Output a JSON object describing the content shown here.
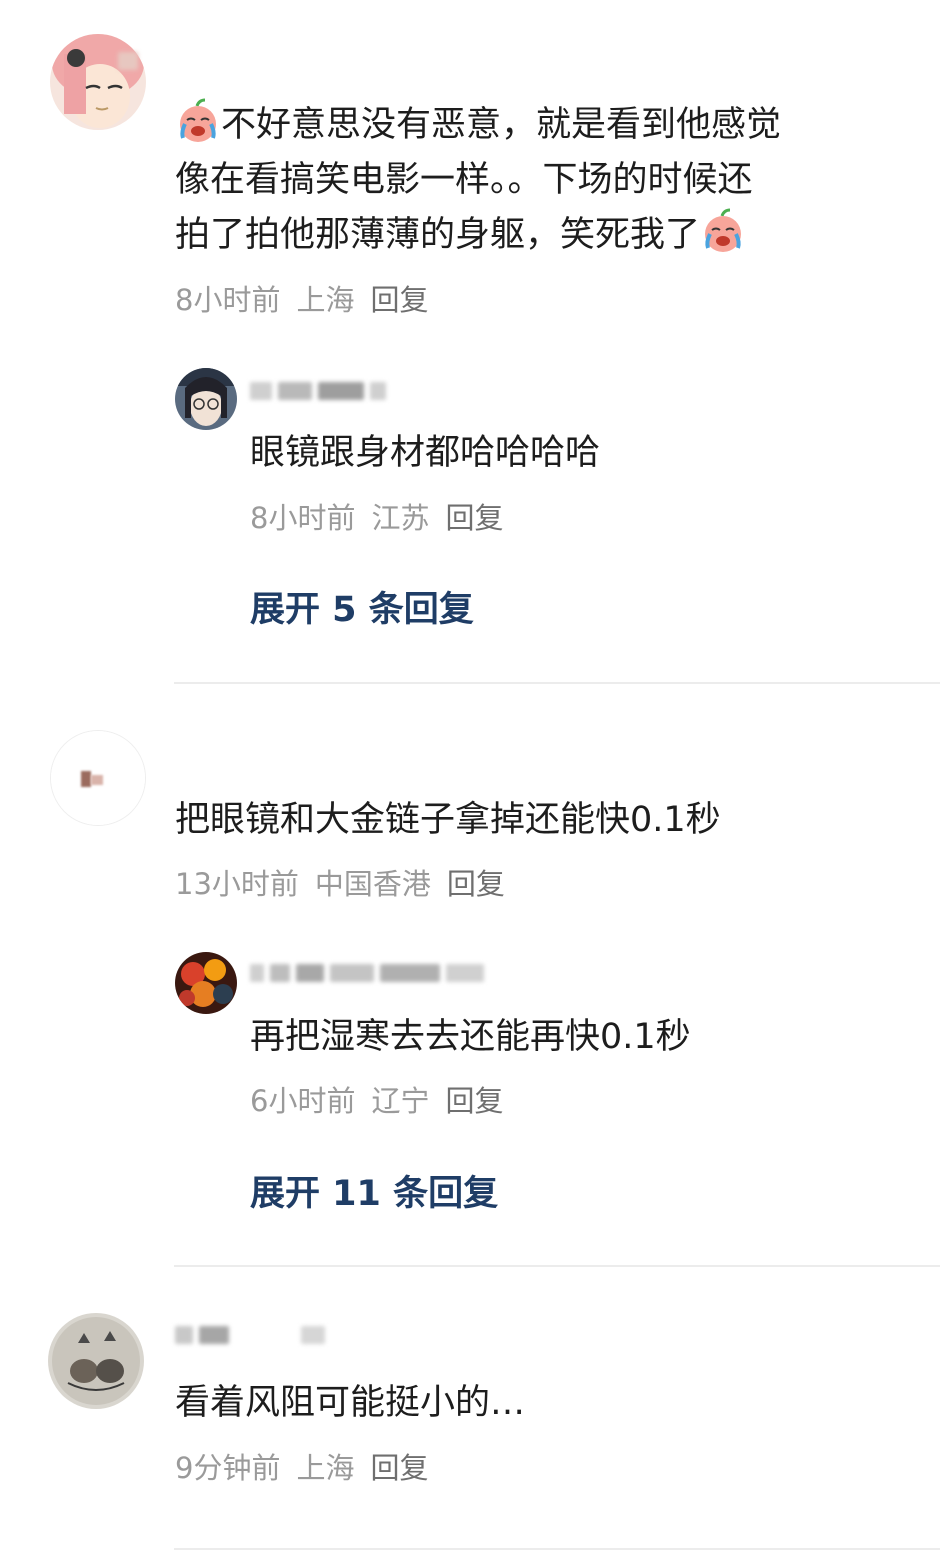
{
  "comments": [
    {
      "text_line1": "不好意思没有恶意，就是看到他感觉",
      "text_line2": "像在看搞笑电影一样。。下场的时候还",
      "text_line3": "拍了拍他那薄薄的身躯，笑死我了",
      "time": "8小时前",
      "location": "上海",
      "reply_label": "回复",
      "emoji_icon": "crying-laughing-peach-emoji",
      "sub_reply": {
        "text": "眼镜跟身材都哈哈哈哈",
        "time": "8小时前",
        "location": "江苏",
        "reply_label": "回复"
      },
      "expand_label": "展开 5 条回复"
    },
    {
      "text_line1": "把眼镜和大金链子拿掉还能快0.1秒",
      "time": "13小时前",
      "location": "中国香港",
      "reply_label": "回复",
      "sub_reply": {
        "text": "再把湿寒去去还能再快0.1秒",
        "time": "6小时前",
        "location": "辽宁",
        "reply_label": "回复"
      },
      "expand_label": "展开 11 条回复"
    },
    {
      "text_line1": "看着风阻可能挺小的…",
      "time": "9分钟前",
      "location": "上海",
      "reply_label": "回复"
    }
  ],
  "colors": {
    "link": "#1f3d66",
    "meta": "#9a9a9a",
    "divider": "#ececec"
  }
}
